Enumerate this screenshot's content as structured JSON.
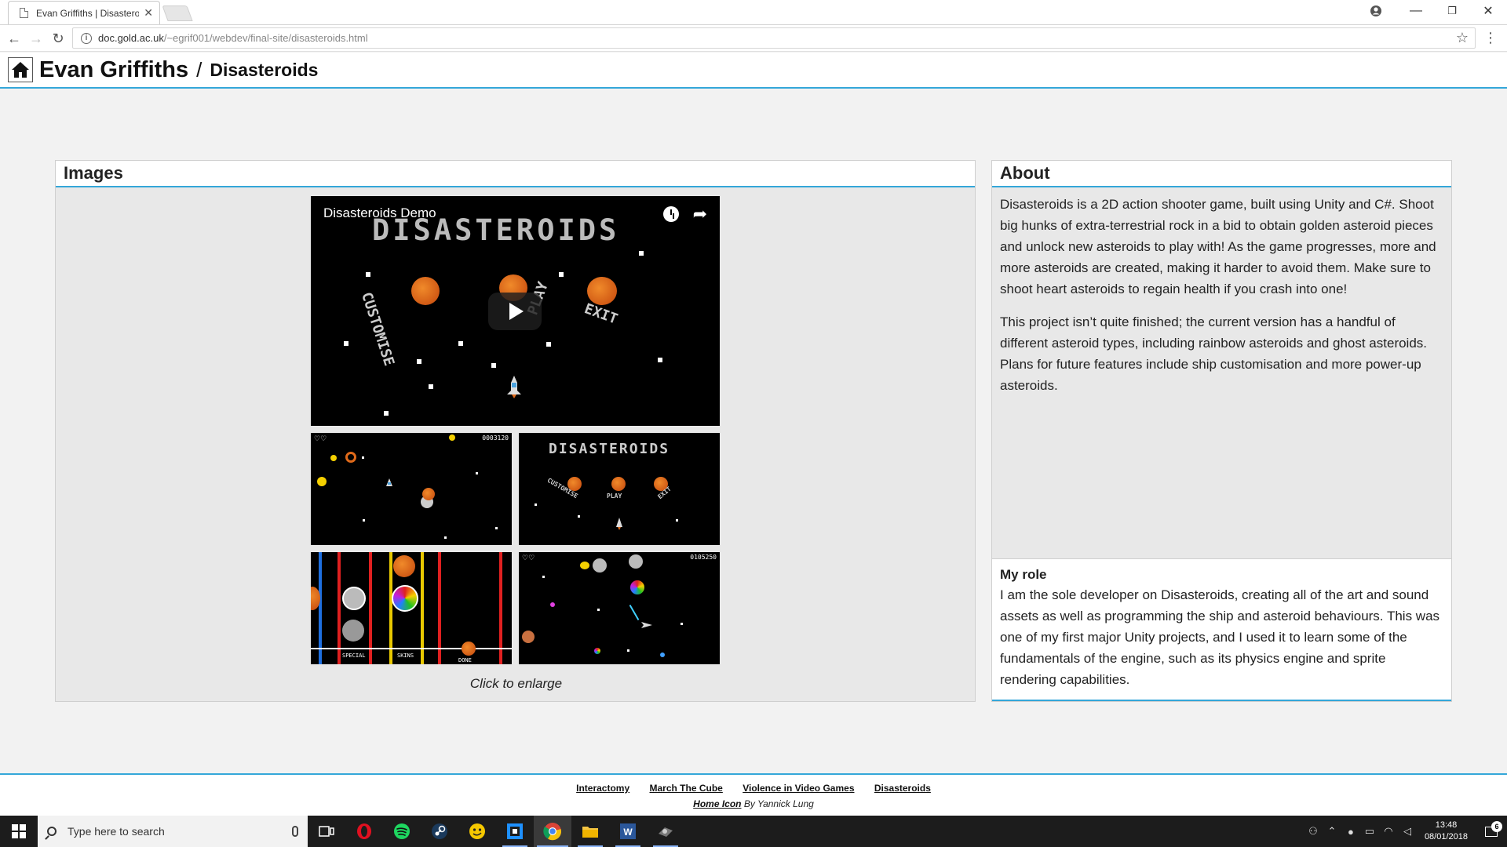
{
  "browser": {
    "tab_title": "Evan Griffiths | Disasteroids",
    "url_host": "doc.gold.ac.uk",
    "url_path": "/~egrif001/webdev/final-site/disasteroids.html"
  },
  "header": {
    "site_name": "Evan Griffiths",
    "separator": "/",
    "page_name": "Disasteroids"
  },
  "images": {
    "heading": "Images",
    "video_title": "Disasteroids Demo",
    "video_logo": "DISASTEROIDS",
    "video_menu": {
      "customise": "CUSTOMISE",
      "play": "PLAY",
      "exit": "EXIT"
    },
    "thumb_logo": "DISASTEROIDS",
    "thumb_menu": {
      "customise": "CUSTOMISE",
      "play": "PLAY",
      "exit": "EXIT"
    },
    "thumb1_score": "0003120",
    "thumb4_score": "0105250",
    "thumb3_labels": [
      "SPECIAL",
      "SKINS",
      "DONE"
    ],
    "caption": "Click to enlarge"
  },
  "about": {
    "heading": "About",
    "p1": "Disasteroids is a 2D action shooter game, built using Unity and C#. Shoot big hunks of extra-terrestrial rock in a bid to obtain golden asteroid pieces and unlock new asteroids to play with! As the game progresses, more and more asteroids are created, making it harder to avoid them. Make sure to shoot heart asteroids to regain health if you crash into one!",
    "p2": "This project isn’t quite finished; the current version has a handful of different asteroid types, including rainbow asteroids and ghost asteroids. Plans for future features include ship customisation and more power-up asteroids.",
    "role_title": "My role",
    "role_text": "I am the sole developer on Disasteroids, creating all of the art and sound assets as well as programming the ship and asteroid behaviours. This was one of my first major Unity projects, and I used it to learn some of the fundamentals of the engine, such as its physics engine and sprite rendering capabilities."
  },
  "footer": {
    "links": [
      "Interactomy",
      "March The Cube",
      "Violence in Video Games",
      "Disasteroids"
    ],
    "credit_link": "Home Icon",
    "credit_rest": " By Yannick Lung"
  },
  "taskbar": {
    "search_placeholder": "Type here to search",
    "time": "13:48",
    "date": "08/01/2018",
    "notification_count": "6"
  },
  "colors": {
    "accent": "#34a7d9",
    "panel_bg": "#e8e8e8",
    "page_bg": "#f2f2f2",
    "asteroid": "#e06a1a"
  }
}
